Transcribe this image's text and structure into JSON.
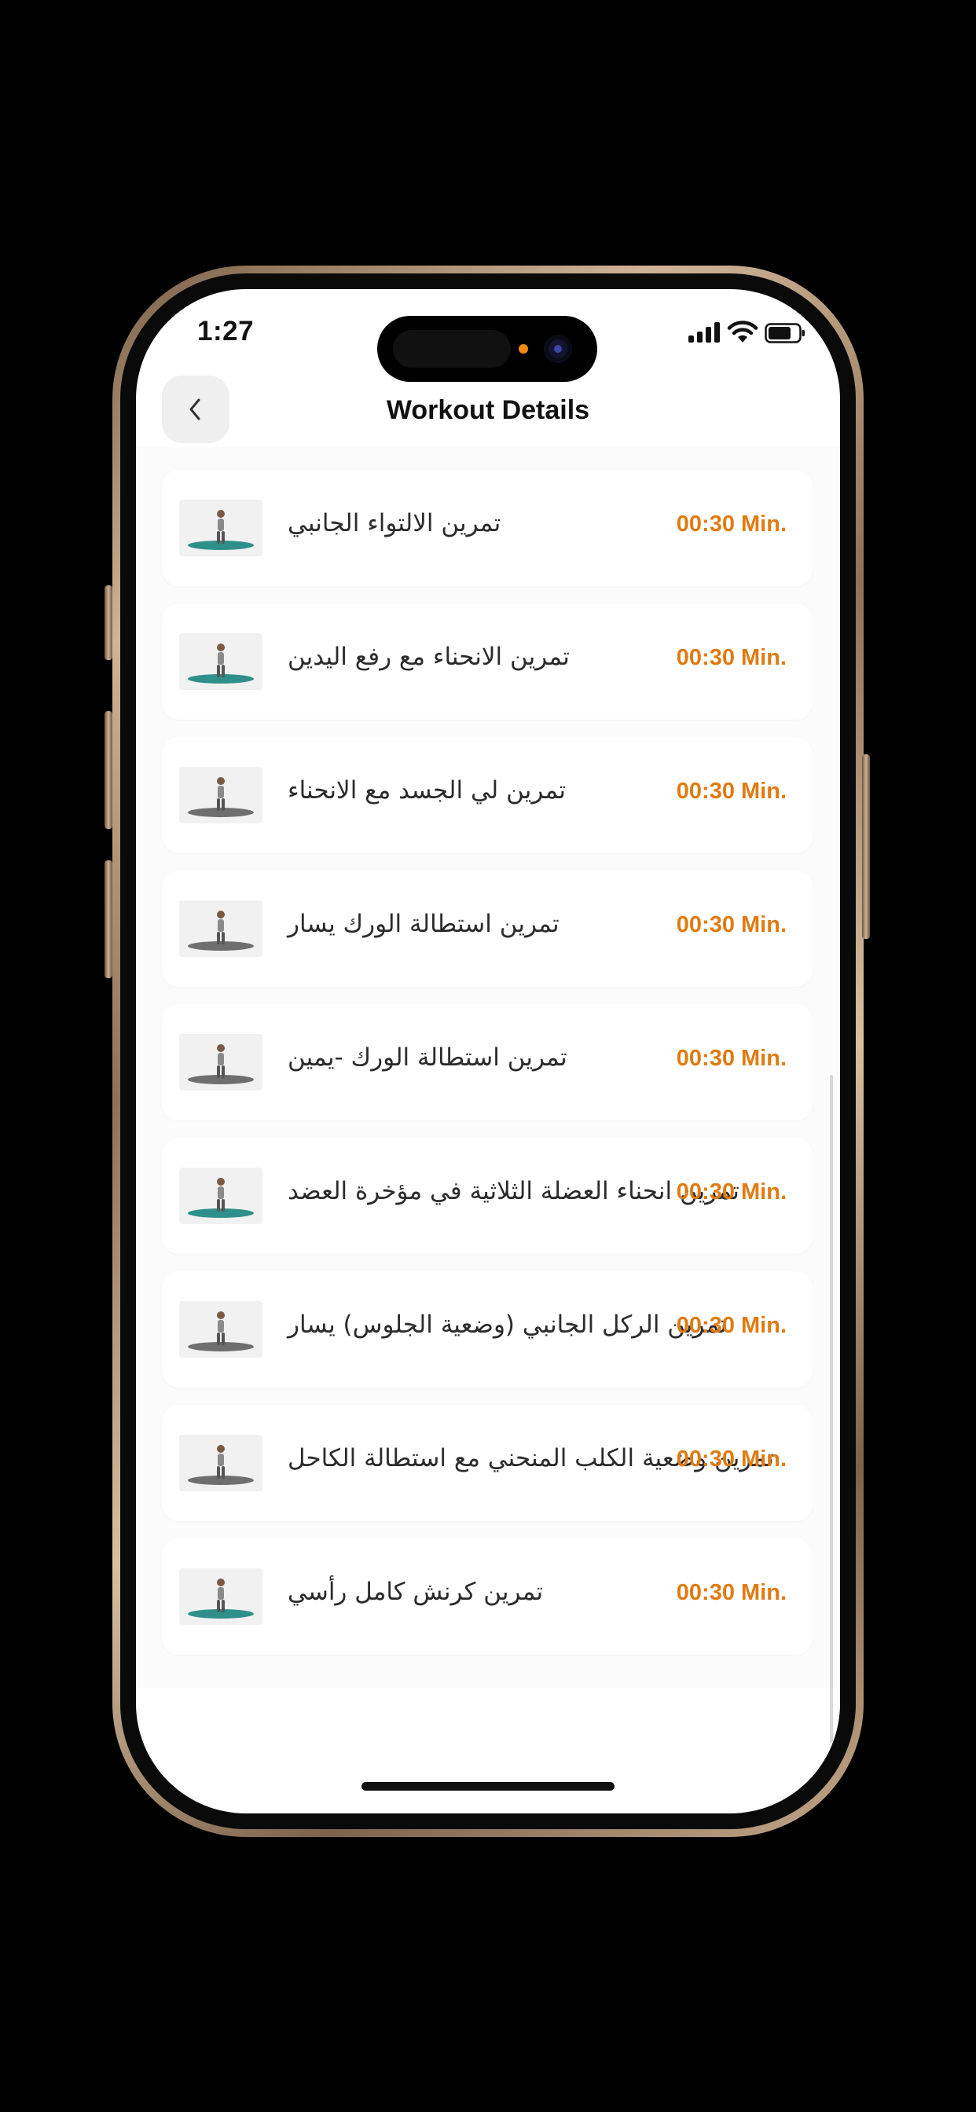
{
  "status_bar": {
    "time": "1:27"
  },
  "header": {
    "title": "Workout Details",
    "back_icon": "chevron-left-icon"
  },
  "exercises": [
    {
      "name": "تمرين الالتواء الجانبي",
      "duration": "00:30 Min.",
      "thumb_color": "#2f8f8a"
    },
    {
      "name": "تمرين الانحناء مع رفع اليدين",
      "duration": "00:30 Min.",
      "thumb_color": "#2f8f8a"
    },
    {
      "name": "تمرين لي الجسد مع الانحناء",
      "duration": "00:30 Min.",
      "thumb_color": "#6e6e6e"
    },
    {
      "name": "تمرين استطالة الورك يسار",
      "duration": "00:30 Min.",
      "thumb_color": "#6e6e6e"
    },
    {
      "name": "تمرين استطالة الورك -يمين",
      "duration": "00:30 Min.",
      "thumb_color": "#6e6e6e"
    },
    {
      "name": "تمرين انحناء العضلة الثلاثية في مؤخرة العضد",
      "duration": "00:30 Min.",
      "thumb_color": "#2f8f8a"
    },
    {
      "name": "تمرين الركل الجانبي (وضعية الجلوس) يسار",
      "duration": "00:30 Min.",
      "thumb_color": "#6e6e6e"
    },
    {
      "name": "تمرين وضعية الكلب المنحني مع استطالة الكاحل",
      "duration": "00:30 Min.",
      "thumb_color": "#6e6e6e"
    },
    {
      "name": "تمرين كرنش كامل رأسي",
      "duration": "00:30 Min.",
      "thumb_color": "#2f8f8a"
    }
  ],
  "colors": {
    "accent": "#e07b12",
    "background": "#fbfbfb",
    "card": "#ffffff"
  }
}
